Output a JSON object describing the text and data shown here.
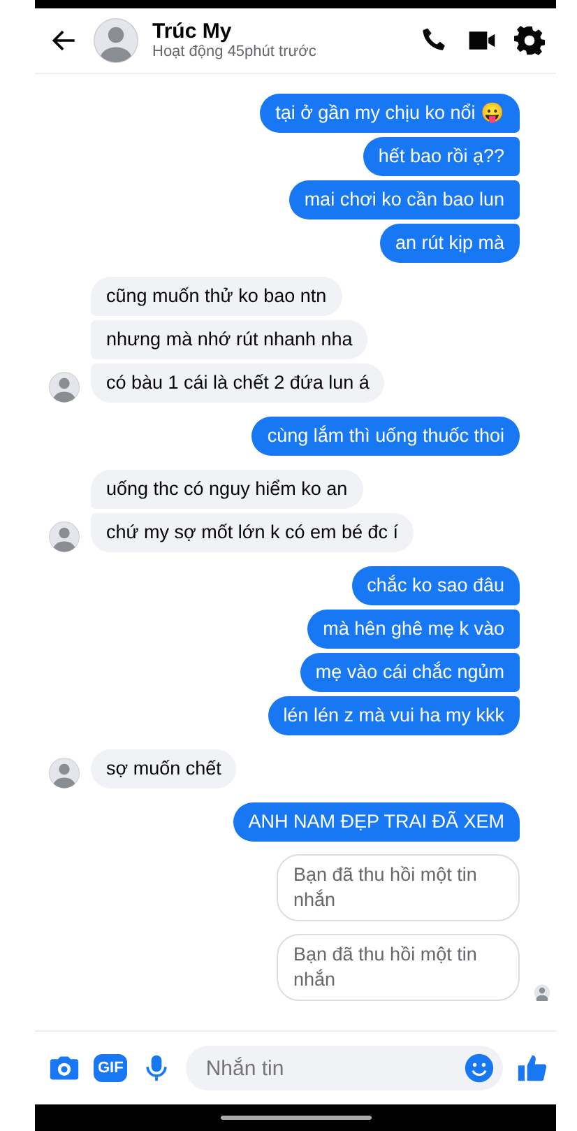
{
  "header": {
    "name": "Trúc My",
    "status": "Hoạt động 45phút trước"
  },
  "groups": [
    {
      "kind": "outgoing",
      "messages": [
        {
          "kind": "text",
          "text": "tại ở gần my chịu ko nổi 😛"
        },
        {
          "kind": "text",
          "text": "hết bao rồi ạ??"
        },
        {
          "kind": "text",
          "text": "mai chơi ko cần bao lun"
        },
        {
          "kind": "text",
          "text": "an rút kịp mà"
        }
      ]
    },
    {
      "kind": "incoming",
      "messages": [
        {
          "kind": "text",
          "text": "cũng muốn thử ko bao ntn"
        },
        {
          "kind": "text",
          "text": "nhưng mà nhớ rút nhanh nha"
        },
        {
          "kind": "text",
          "text": "có bàu 1 cái là chết 2 đứa lun á"
        }
      ]
    },
    {
      "kind": "outgoing",
      "messages": [
        {
          "kind": "text",
          "text": "cùng lắm thì uống thuốc thoi"
        }
      ]
    },
    {
      "kind": "incoming",
      "messages": [
        {
          "kind": "text",
          "text": "uống thc có nguy hiểm ko an"
        },
        {
          "kind": "text",
          "text": "chứ my sợ mốt lớn k có em bé đc í"
        }
      ]
    },
    {
      "kind": "outgoing",
      "messages": [
        {
          "kind": "text",
          "text": "chắc ko sao đâu"
        },
        {
          "kind": "text",
          "text": "mà hên ghê mẹ k vào"
        },
        {
          "kind": "text",
          "text": "mẹ vào cái chắc ngủm"
        },
        {
          "kind": "text",
          "text": "lén lén z mà vui ha my kkk"
        }
      ]
    },
    {
      "kind": "incoming",
      "messages": [
        {
          "kind": "text",
          "text": "sợ muốn chết"
        }
      ]
    },
    {
      "kind": "outgoing",
      "messages": [
        {
          "kind": "text",
          "text": "ANH NAM ĐẸP TRAI ĐÃ XEM"
        },
        {
          "kind": "recalled",
          "text": "Bạn đã thu hồi một tin nhắn"
        },
        {
          "kind": "recalled",
          "text": "Bạn đã thu hồi một tin nhắn"
        }
      ]
    }
  ],
  "composer": {
    "placeholder": "Nhắn tin",
    "gif_label": "GIF"
  }
}
